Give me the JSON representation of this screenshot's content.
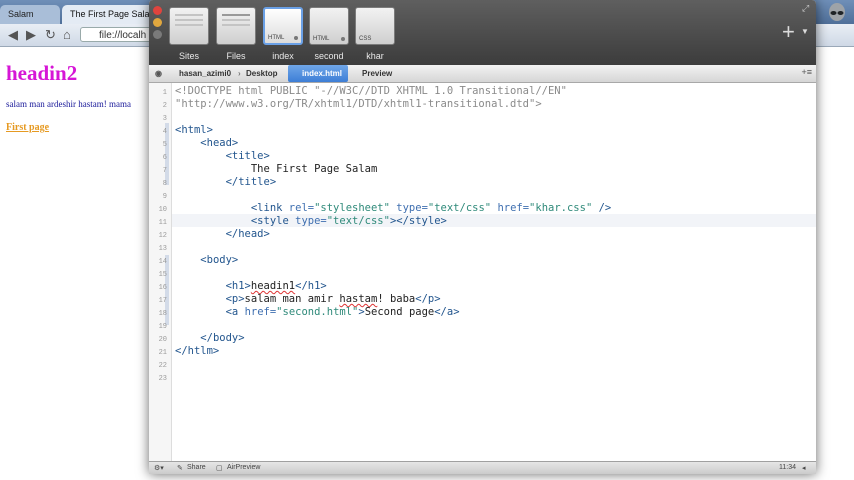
{
  "browser": {
    "tabs": [
      {
        "label": "Salam"
      },
      {
        "label": "The First Page Salam"
      }
    ],
    "url": "file://localh",
    "page": {
      "heading": "headin2",
      "paragraph": "salam man ardeshir hastam! mama",
      "link": "First page"
    }
  },
  "coda": {
    "sites": [
      {
        "label": "Sites",
        "tag": ""
      },
      {
        "label": "Files",
        "tag": ""
      },
      {
        "label": "index",
        "tag": "HTML",
        "selected": true
      },
      {
        "label": "second",
        "tag": "HTML"
      },
      {
        "label": "khar",
        "tag": "CSS"
      }
    ],
    "path": {
      "user": "hasan_azimi0",
      "folder": "Desktop",
      "file": "index.html",
      "preview": "Preview"
    },
    "status": {
      "share": "Share",
      "airpreview": "AirPreview",
      "position": "11:34"
    }
  },
  "code_lines": {
    "l1": "<!DOCTYPE html PUBLIC \"-//W3C//DTD XHTML 1.0 Transitional//EN\"",
    "l2": "\"http://www.w3.org/TR/xhtml1/DTD/xhtml1-transitional.dtd\">",
    "l7": "The First Page Salam"
  },
  "line_numbers": [
    "1",
    "2",
    "3",
    "4",
    "5",
    "6",
    "7",
    "8",
    "9",
    "10",
    "11",
    "12",
    "13",
    "14",
    "15",
    "16",
    "17",
    "18",
    "19",
    "20",
    "21",
    "22",
    "23"
  ],
  "colors": {
    "heading": "#d616d6",
    "paragraph": "#1a1a9a",
    "link": "#e69a22",
    "selection": "#6aa0e6"
  }
}
